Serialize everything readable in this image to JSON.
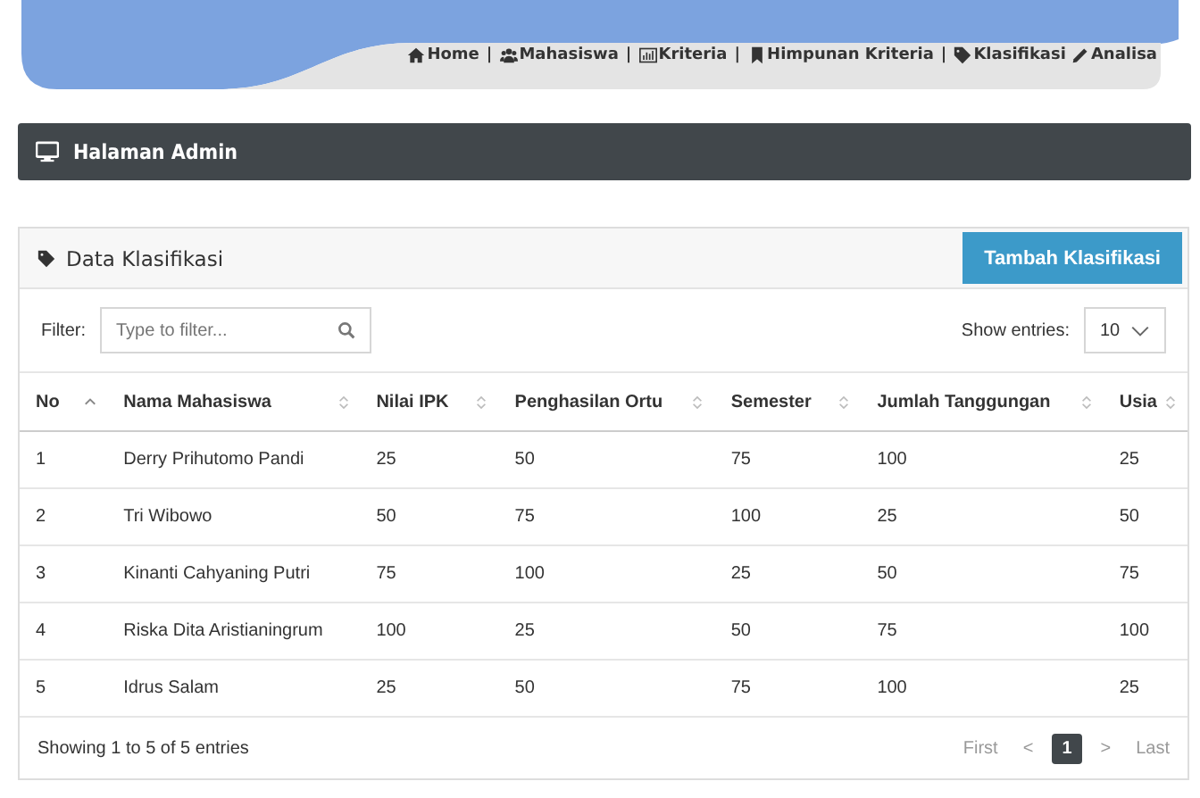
{
  "nav": [
    {
      "kind": "link",
      "label": "Home"
    },
    {
      "kind": "separator",
      "label": "|"
    },
    {
      "kind": "link",
      "label": "Mahasiswa"
    },
    {
      "kind": "separator",
      "label": "|"
    },
    {
      "kind": "link",
      "label": "Kriteria"
    },
    {
      "kind": "separator",
      "label": "|"
    },
    {
      "kind": "link",
      "label": "Himpunan Kriteria"
    },
    {
      "kind": "separator",
      "label": "|"
    },
    {
      "kind": "link",
      "label": "Klasifikasi"
    },
    {
      "kind": "link",
      "label": "Analisa"
    }
  ],
  "admin_bar": {
    "title": "Halaman Admin"
  },
  "card": {
    "title": "Data Klasifikasi",
    "add_button": "Tambah Klasifikasi"
  },
  "filter": {
    "label": "Filter:",
    "placeholder": "Type to filter..."
  },
  "show_entries": {
    "label": "Show entries:",
    "value": "10"
  },
  "table": {
    "columns": [
      {
        "label": "No",
        "sorted": true
      },
      {
        "label": "Nama Mahasiswa",
        "sorted": false
      },
      {
        "label": "Nilai IPK",
        "sorted": false
      },
      {
        "label": "Penghasilan Ortu",
        "sorted": false
      },
      {
        "label": "Semester",
        "sorted": false
      },
      {
        "label": "Jumlah Tanggungan",
        "sorted": false
      },
      {
        "label": "Usia",
        "sorted": false
      }
    ],
    "rows": [
      [
        "1",
        "Derry Prihutomo Pandi",
        "25",
        "50",
        "75",
        "100",
        "25"
      ],
      [
        "2",
        "Tri Wibowo",
        "50",
        "75",
        "100",
        "25",
        "50"
      ],
      [
        "3",
        "Kinanti Cahyaning Putri",
        "75",
        "100",
        "25",
        "50",
        "75"
      ],
      [
        "4",
        "Riska Dita Aristianingrum",
        "100",
        "25",
        "50",
        "75",
        "100"
      ],
      [
        "5",
        "Idrus Salam",
        "25",
        "50",
        "75",
        "100",
        "25"
      ]
    ]
  },
  "footer": {
    "info": "Showing 1 to 5 of 5 entries",
    "pagination": [
      {
        "label": "First",
        "selected": false
      },
      {
        "label": "<",
        "selected": false
      },
      {
        "label": "1",
        "selected": true
      },
      {
        "label": ">",
        "selected": false
      },
      {
        "label": "Last",
        "selected": false
      }
    ]
  }
}
